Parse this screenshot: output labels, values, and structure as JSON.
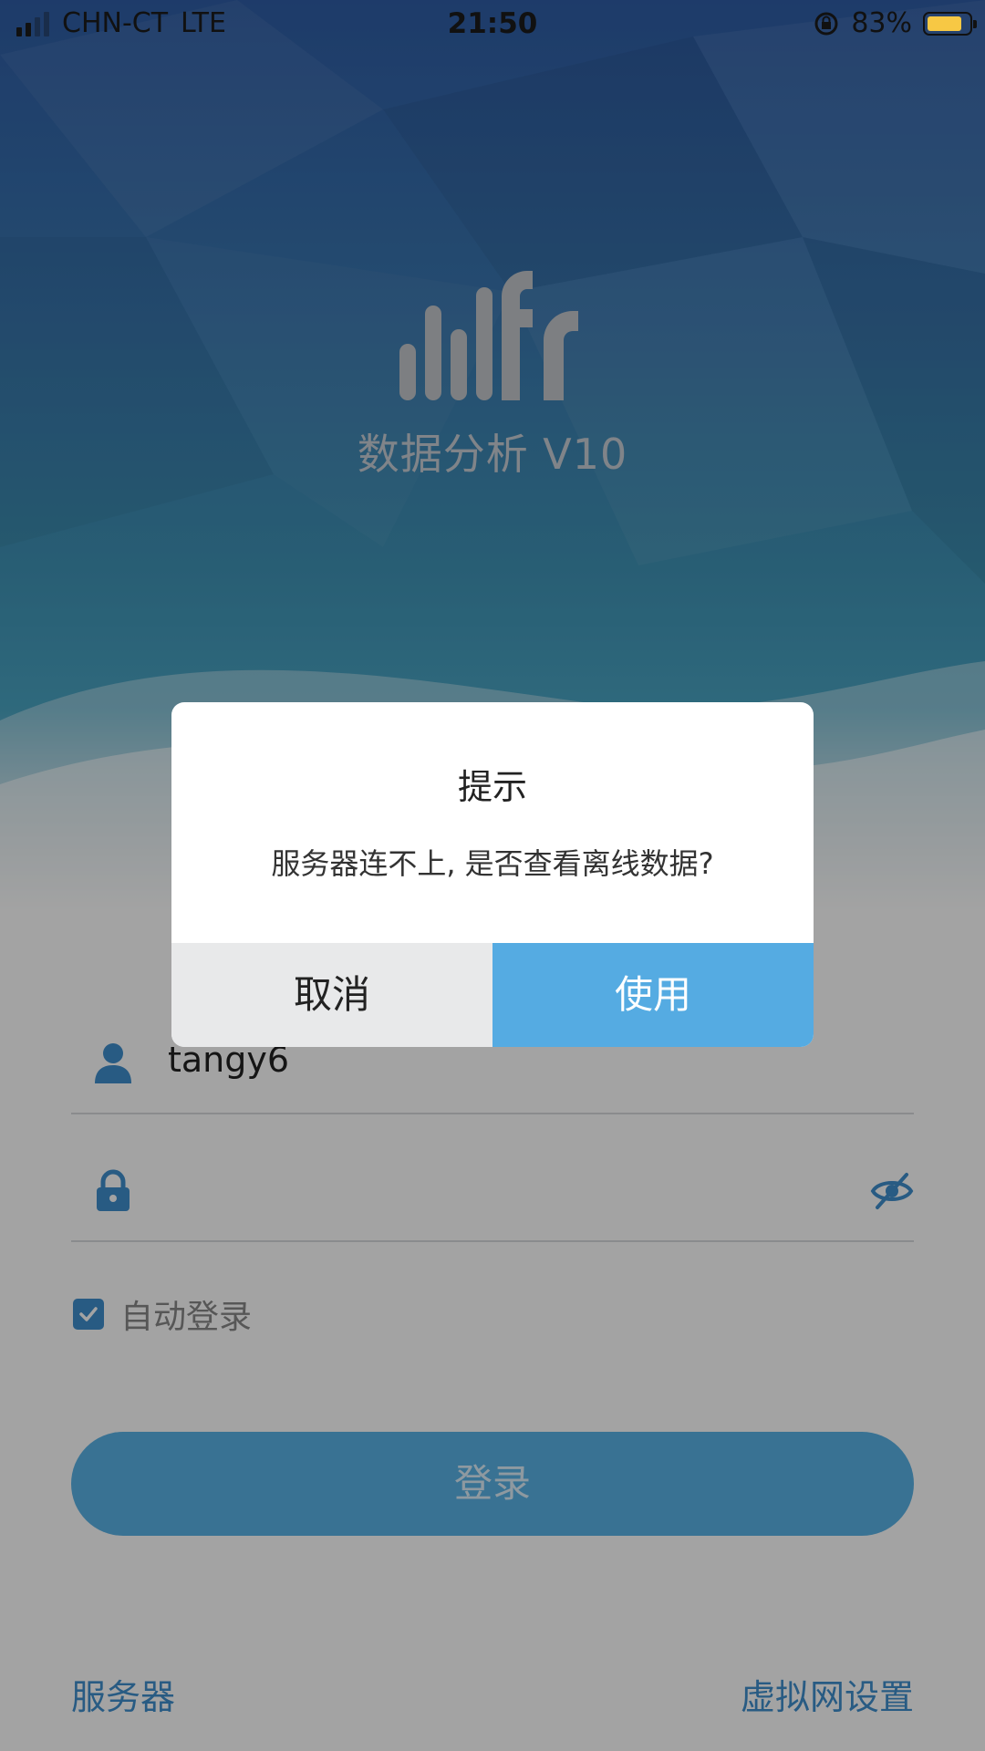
{
  "status_bar": {
    "carrier": "CHN-CT",
    "network": "LTE",
    "time": "21:50",
    "battery_percent_text": "83%",
    "battery_level": 0.83,
    "battery_color": "#f7c844"
  },
  "app": {
    "title": "数据分析 V10",
    "logo_icon": "bars-fr-logo-icon"
  },
  "login_form": {
    "username_value": "tangy6",
    "password_value": "",
    "auto_login_label": "自动登录",
    "auto_login_checked": true,
    "login_button_label": "登录"
  },
  "footer": {
    "server_link": "服务器",
    "vpn_settings_link": "虚拟网设置"
  },
  "dialog": {
    "title": "提示",
    "message": "服务器连不上, 是否查看离线数据?",
    "cancel_label": "取消",
    "confirm_label": "使用"
  },
  "colors": {
    "accent": "#3f8fce",
    "confirm_button": "#55abe2",
    "login_button": "#5ab3e6"
  },
  "icons": {
    "user": "user-icon",
    "lock": "lock-icon",
    "eye": "eye-slash-icon",
    "checkbox": "checkmark-icon",
    "rotation_lock": "rotation-lock-icon"
  }
}
